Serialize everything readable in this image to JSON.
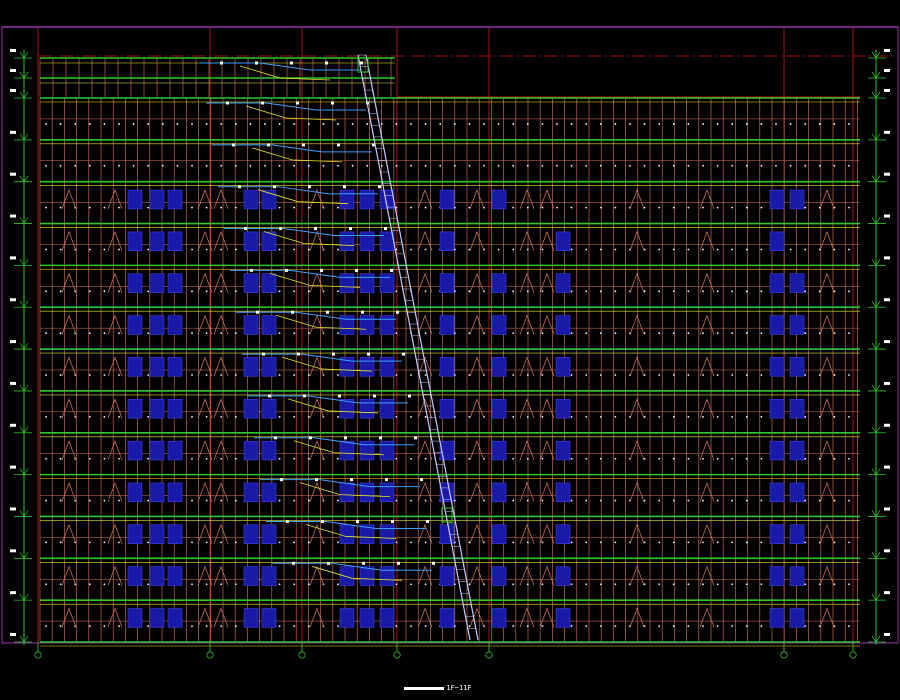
{
  "drawing": {
    "title_label": "1F~11F",
    "colors": {
      "background": "#000000",
      "frame": "#9a2fb0",
      "axis": "#d01818",
      "grid": "#e07a5a",
      "floor_beam": "#2ec82e",
      "beam_band": "#e6e62a",
      "pipe": "#3aa0ff",
      "stair": "#c8c8ff",
      "equipment": "#1a1aa8",
      "marker": "#ffffff"
    },
    "floor_count": 14,
    "axis_markers": 7
  }
}
